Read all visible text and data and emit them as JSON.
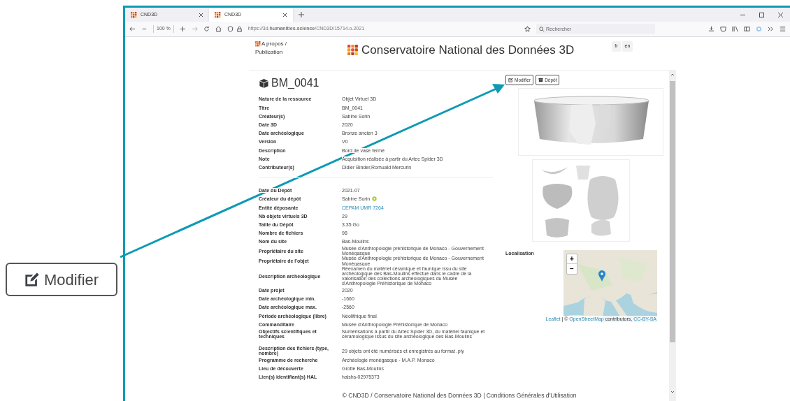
{
  "callout": {
    "label": "Modifier"
  },
  "browser": {
    "tabs": [
      {
        "title": "CND3D",
        "selected": false
      },
      {
        "title": "CND3D",
        "selected": true
      }
    ],
    "zoom": "100 %",
    "url": "https://3d.**humanities.science**/CND3D/15714.o.2021",
    "search": {
      "placeholder": "Rechercher"
    }
  },
  "header": {
    "nav_link": "A propos / Publication",
    "site_title": "Conservatoire National des Données 3D",
    "languages": [
      "fr",
      "en"
    ]
  },
  "record": {
    "title": "BM_0041",
    "buttons": [
      "Modifier",
      "Dépôt"
    ],
    "groups": [
      {
        "ruled_below": true,
        "fields": [
          {
            "label": "Nature de la ressource",
            "value": "Objet Virtuel 3D",
            "kind": "text"
          },
          {
            "label": "Titre",
            "value": "BM_0041",
            "kind": "text"
          },
          {
            "label": "Créateur(s)",
            "value": "Sabine Sorin",
            "kind": "text"
          },
          {
            "label": "Date 3D",
            "value": "2020",
            "kind": "text"
          },
          {
            "label": "Date archéologique",
            "value": "Bronze ancien 3",
            "kind": "text"
          },
          {
            "label": "Version",
            "value": "V0",
            "kind": "text"
          },
          {
            "label": "Description",
            "value": "Bord de vase fermé",
            "kind": "text"
          },
          {
            "label": "Note",
            "value": "Acquisition réalisée à partir du Artec Spider 3D",
            "kind": "text"
          },
          {
            "label": "Contributeur(s)",
            "value": "Didier Binder,Romuald Mercurin",
            "kind": "text"
          }
        ]
      },
      {
        "ruled_below": false,
        "fields": [
          {
            "label": "Date du Dépôt",
            "value": "2021-07",
            "kind": "text"
          },
          {
            "label": "Créateur du dépôt",
            "value": "Sabine Sorin",
            "kind": "person"
          },
          {
            "label": "Entité déposante",
            "value": "CEPAM UMR 7264",
            "kind": "link"
          },
          {
            "label": "Nb objets virtuels 3D",
            "value": "29",
            "kind": "text"
          },
          {
            "label": "Taille du Dépôt",
            "value": "3.35 Go",
            "kind": "text"
          },
          {
            "label": "Nombre de fichiers",
            "value": "98",
            "kind": "text"
          },
          {
            "label": "Nom du site",
            "value": "Bas-Moulins",
            "kind": "text"
          },
          {
            "label": "Propriétaire du site",
            "value": "Musée d'Anthropologie préhistorique de Monaco - Gouvernement Monégasque",
            "kind": "text"
          },
          {
            "label": "Propriétaire de l'objet",
            "value": "Musée d'Anthropologie préhistorique de Monaco - Gouvernement Monégasque",
            "kind": "text"
          },
          {
            "label": "Description archéologique",
            "value": "Réexamen du matériel céramique et faunique issu du site archéologique des Bas-Moulins effectué dans le cadre de la valorisation des collections archéologiques du Musée d'Anthropologie Préhistorique de Monaco",
            "kind": "text"
          },
          {
            "label": "Date projet",
            "value": "2020",
            "kind": "text"
          },
          {
            "label": "Date archéologique min.",
            "value": "-1660",
            "kind": "text"
          },
          {
            "label": "Date archéologique max.",
            "value": "-2560",
            "kind": "text"
          },
          {
            "label": "Période archéologique (libre)",
            "value": "Néolithique final",
            "kind": "text"
          },
          {
            "label": "Commanditaire",
            "value": "Musée d'Anthropologie Préhistorique de Monaco",
            "kind": "text"
          },
          {
            "label": "Objectifs scientifiques et techniques",
            "value": "Numérisations à partir du Artec Spider 3D, du matériel faunique et céramologique issus du site archéologique des Bas-Moulins",
            "kind": "text"
          }
        ]
      },
      {
        "ruled_below": false,
        "fields": [
          {
            "label": "Description des fichiers (type, nombre)",
            "value": "29 objets ont été numérisés et enregistrés au format .ply",
            "kind": "text"
          },
          {
            "label": "Programme de recherche",
            "value": "Archéologie monégasque - M.A.P. Monaco",
            "kind": "text"
          },
          {
            "label": "Lieu de découverte",
            "value": "Grotte Bas-Moulins",
            "kind": "text"
          },
          {
            "label": "Lien(s) identifiant(s) HAL",
            "value": "halshs-02975373",
            "kind": "text"
          }
        ]
      }
    ],
    "localisation": {
      "label": "Localisation",
      "zoom_in": "+",
      "zoom_out": "−",
      "attribution": [
        {
          "text": "Leaflet",
          "kind": "link"
        },
        {
          "text": " | © ",
          "kind": "text"
        },
        {
          "text": "OpenStreetMap",
          "kind": "link"
        },
        {
          "text": " contributors, ",
          "kind": "text"
        },
        {
          "text": "CC-BY-SA",
          "kind": "link"
        }
      ]
    }
  },
  "footer": "© CND3D / Conservatoire National des Données 3D | Conditions Générales d'Utilisation"
}
